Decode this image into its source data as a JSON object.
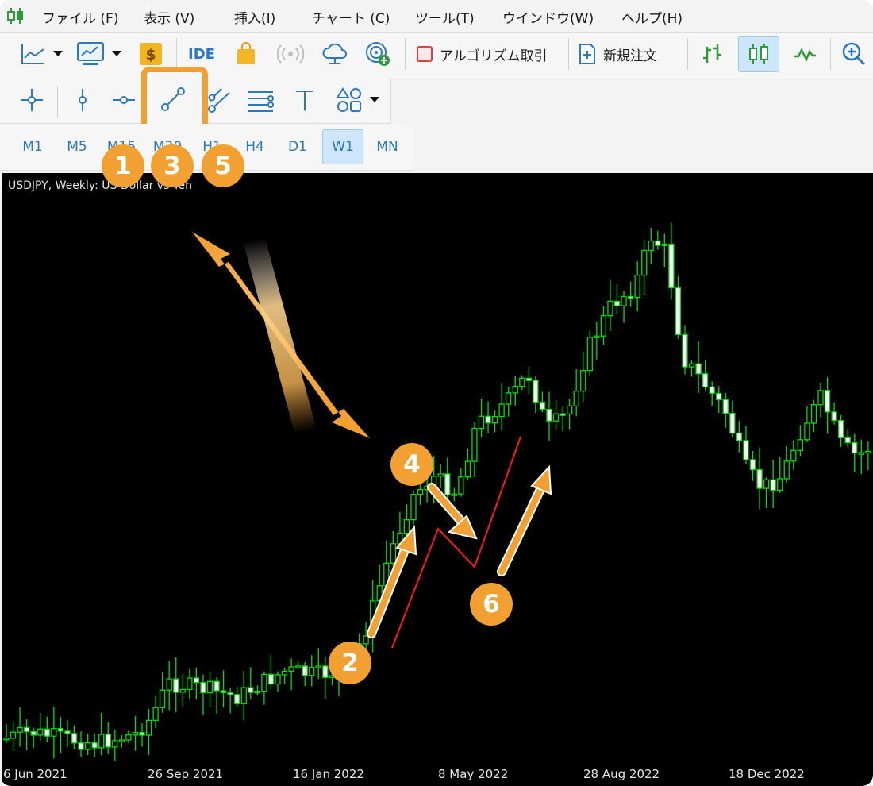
{
  "menu": {
    "items": [
      "ファイル (F)",
      "表示 (V)",
      "挿入(I)",
      "チャート (C)",
      "ツール(T)",
      "ウインドウ(W)",
      "ヘルプ(H)"
    ]
  },
  "toolbar": {
    "ide_label": "IDE",
    "algo_label": "アルゴリズム取引",
    "new_order_label": "新規注文"
  },
  "timeframes": {
    "items": [
      "M1",
      "M5",
      "M15",
      "M30",
      "H1",
      "H4",
      "D1",
      "W1",
      "MN"
    ],
    "active": "W1"
  },
  "chart": {
    "title": "USDJPY, Weekly:  US Dollar vs Yen",
    "x_labels": [
      "6 Jun 2021",
      "26 Sep 2021",
      "16 Jan 2022",
      "8 May 2022",
      "28 Aug 2022",
      "18 Dec 2022"
    ],
    "colors": {
      "background": "#000000",
      "candle_outline": "#00e000",
      "bull_body": "#000000",
      "bear_body": "#ffffff",
      "trendline": "#ff0000",
      "annotation": "#f1a031"
    }
  },
  "annotations": {
    "steps": [
      "1",
      "2",
      "3",
      "4",
      "5",
      "6"
    ],
    "highlighted_tool": "trend-line-tool"
  },
  "icons": [
    "chart-logo-icon",
    "line-chart-icon",
    "dropdown-arrow-icon",
    "monitor-chart-icon",
    "market-icon",
    "ide-icon",
    "shopping-bag-icon",
    "signal-icon",
    "cloud-icon",
    "vps-icon",
    "algo-stop-icon",
    "new-order-icon",
    "bar-chart-icon",
    "candlestick-icon",
    "line-icon",
    "zoom-in-icon",
    "crosshair-icon",
    "vertical-line-icon",
    "horizontal-line-icon",
    "trend-line-icon",
    "channel-icon",
    "fibonacci-icon",
    "text-icon",
    "shapes-icon"
  ]
}
